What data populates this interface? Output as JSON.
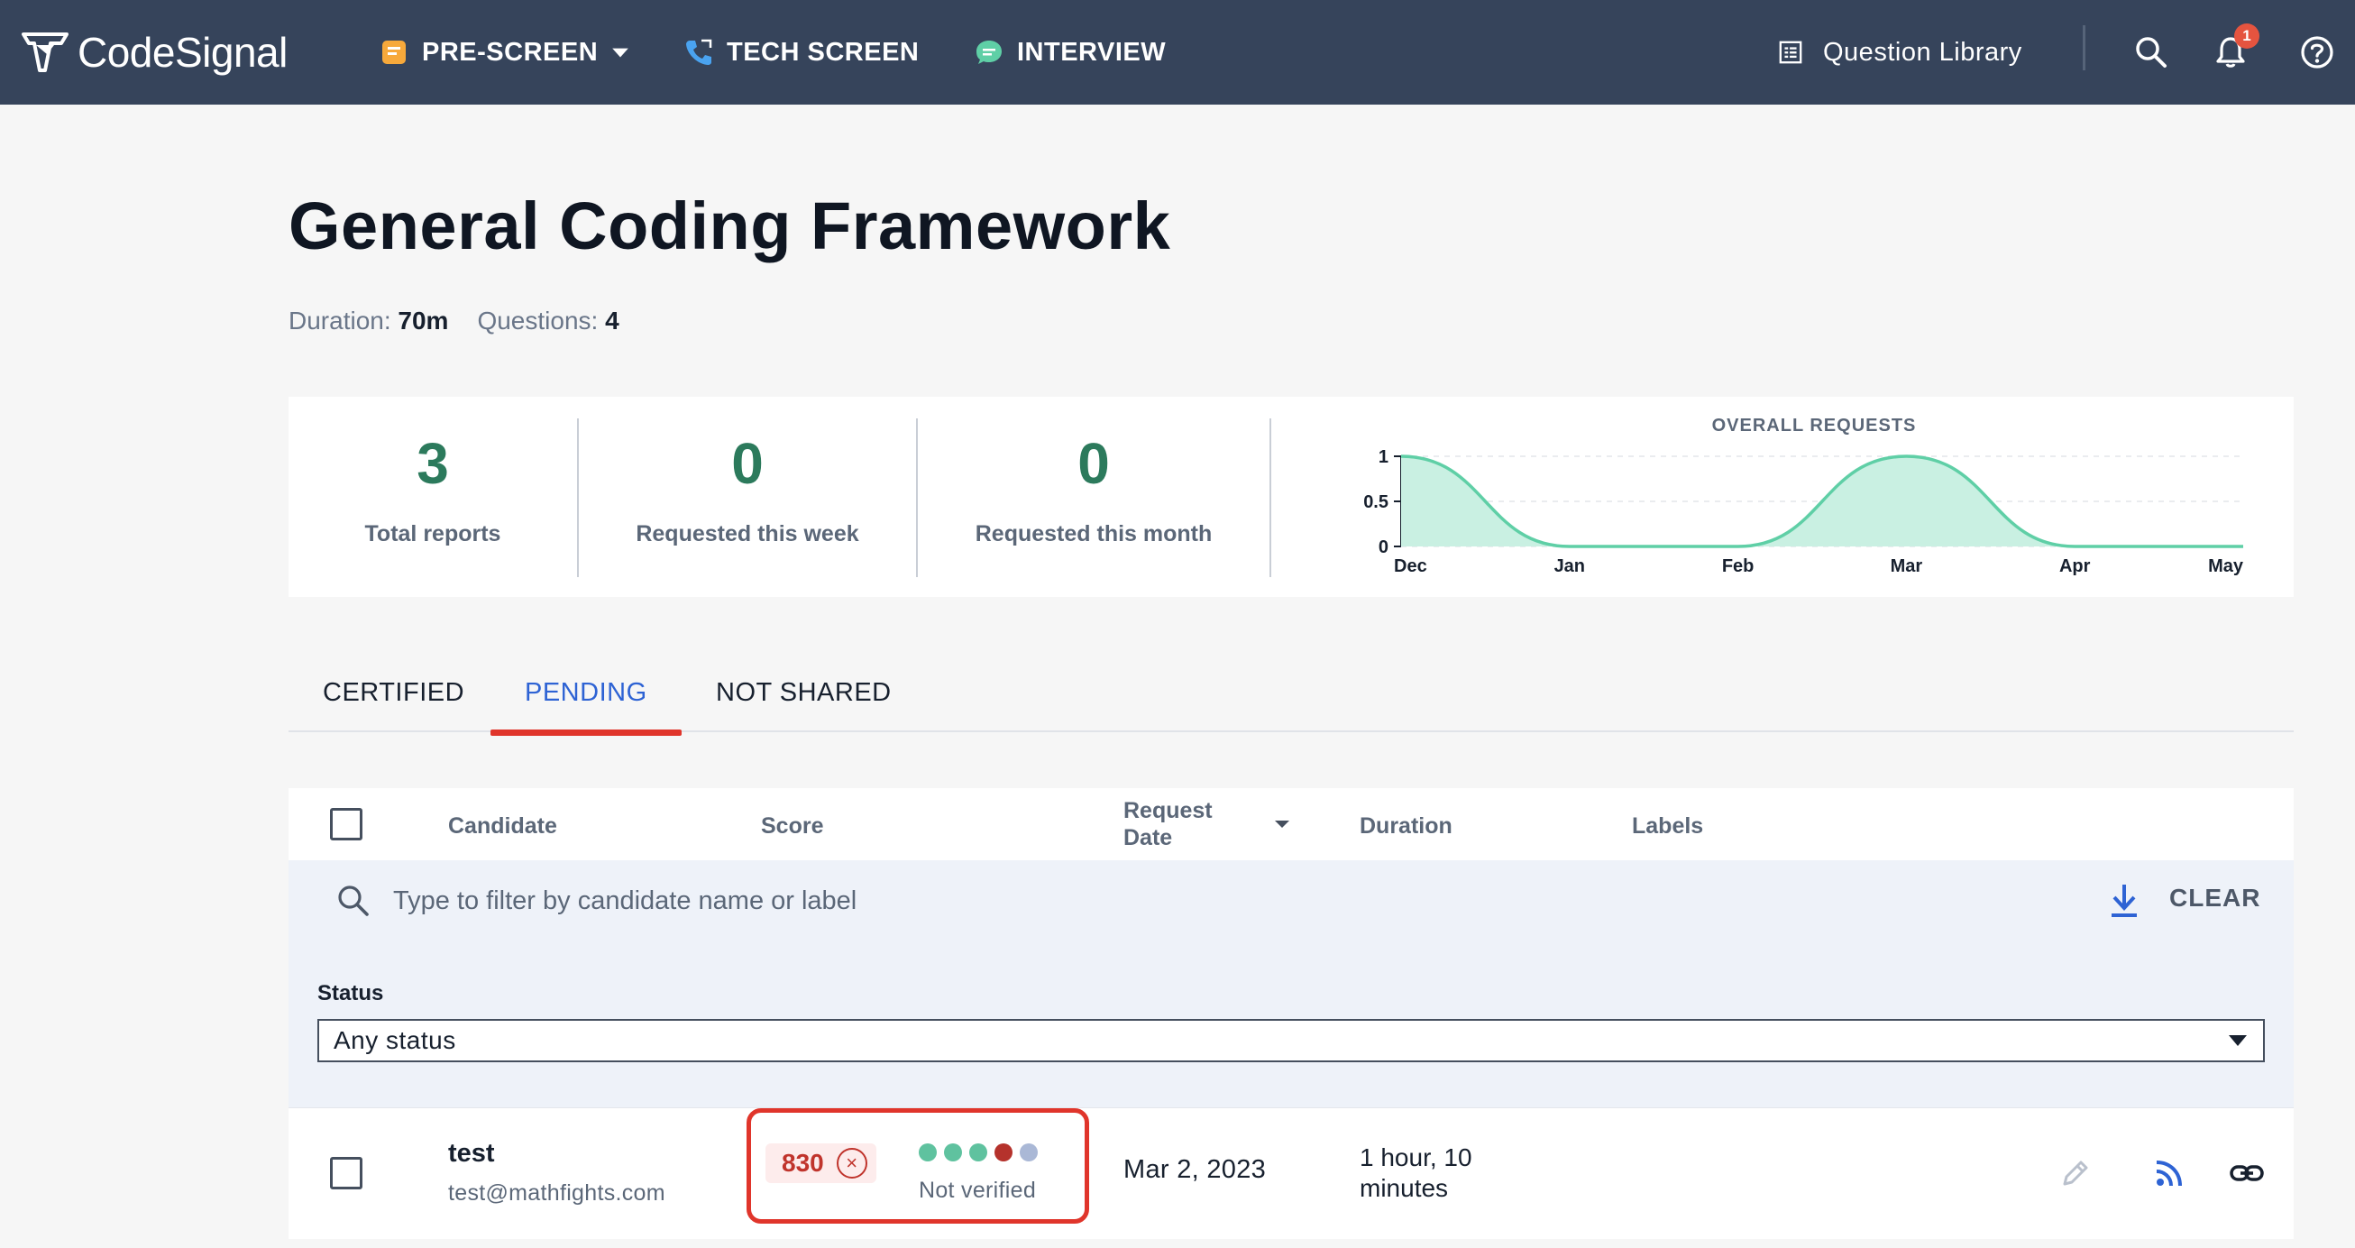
{
  "nav": {
    "logo_text": "CodeSignal",
    "items": [
      {
        "label": "PRE-SCREEN",
        "icon": "prescreen-icon"
      },
      {
        "label": "TECH SCREEN",
        "icon": "phone-icon"
      },
      {
        "label": "INTERVIEW",
        "icon": "chat-icon"
      }
    ],
    "question_library": "Question Library",
    "notification_count": "1"
  },
  "page": {
    "title": "General Coding Framework",
    "duration_label": "Duration:",
    "duration_value": "70m",
    "questions_label": "Questions:",
    "questions_value": "4"
  },
  "stats": [
    {
      "value": "3",
      "label": "Total reports"
    },
    {
      "value": "0",
      "label": "Requested this week"
    },
    {
      "value": "0",
      "label": "Requested this month"
    }
  ],
  "chart_data": {
    "type": "area",
    "title": "OVERALL REQUESTS",
    "x": [
      "Dec",
      "Jan",
      "Feb",
      "Mar",
      "Apr",
      "May"
    ],
    "values": [
      1,
      0,
      0,
      1,
      0,
      0
    ],
    "y_ticks": [
      "1",
      "0.5",
      "0"
    ],
    "ylim": [
      0,
      1
    ],
    "grid": true,
    "color": "#5fcfa6",
    "fill": "#c9f0e2"
  },
  "tabs": [
    {
      "label": "CERTIFIED",
      "active": false
    },
    {
      "label": "PENDING",
      "active": true
    },
    {
      "label": "NOT SHARED",
      "active": false
    }
  ],
  "table": {
    "columns": {
      "candidate": "Candidate",
      "score": "Score",
      "request_date_1": "Request",
      "request_date_2": "Date",
      "duration": "Duration",
      "labels": "Labels"
    },
    "filter_placeholder": "Type to filter by candidate name or label",
    "clear_label": "CLEAR",
    "status_label": "Status",
    "status_value": "Any status",
    "rows": [
      {
        "name": "test",
        "email": "test@mathfights.com",
        "score": "830",
        "dots": [
          "#5fc29f",
          "#5fc29f",
          "#5fc29f",
          "#b5322c",
          "#aab8d6"
        ],
        "verification": "Not verified",
        "request_date": "Mar 2, 2023",
        "duration": "1 hour, 10 minutes"
      }
    ]
  },
  "colors": {
    "accent": "#2e63d4",
    "highlight": "#e0352b",
    "nav_bg": "#36445b"
  }
}
